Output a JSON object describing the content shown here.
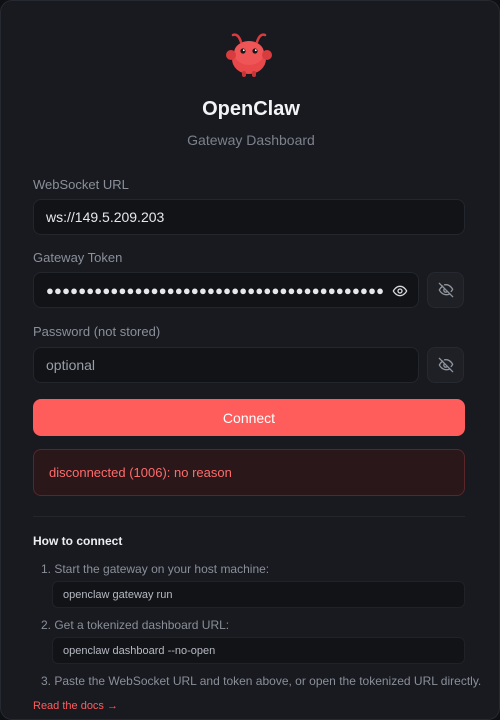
{
  "app": {
    "title": "OpenClaw",
    "subtitle": "Gateway Dashboard",
    "logo_icon": "red-claw-mascot-icon"
  },
  "form": {
    "websocket": {
      "label": "WebSocket URL",
      "value": "ws://149.5.209.203"
    },
    "token": {
      "label": "Gateway Token",
      "value": "●●●●●●●●●●●●●●●●●●●●●●●●●●●●●●●●●●●●●●●●●●●●●●●●",
      "icon": "eye-icon",
      "toggle_icon": "eye-off-icon"
    },
    "password": {
      "label": "Password (not stored)",
      "placeholder": "optional",
      "toggle_icon": "eye-off-icon"
    },
    "connect_label": "Connect"
  },
  "status": {
    "error": "disconnected (1006): no reason"
  },
  "help": {
    "heading": "How to connect",
    "steps": [
      {
        "text": "1. Start the gateway on your host machine:",
        "code": "openclaw gateway run"
      },
      {
        "text": "2. Get a tokenized dashboard URL:",
        "code": "openclaw dashboard --no-open"
      },
      {
        "text": "3. Paste the WebSocket URL and token above, or open the tokenized URL directly."
      }
    ],
    "docs_link": "Read the docs →"
  },
  "colors": {
    "accent": "#ff5c5c",
    "background": "#181a20",
    "error_text": "#ff6b6b"
  }
}
